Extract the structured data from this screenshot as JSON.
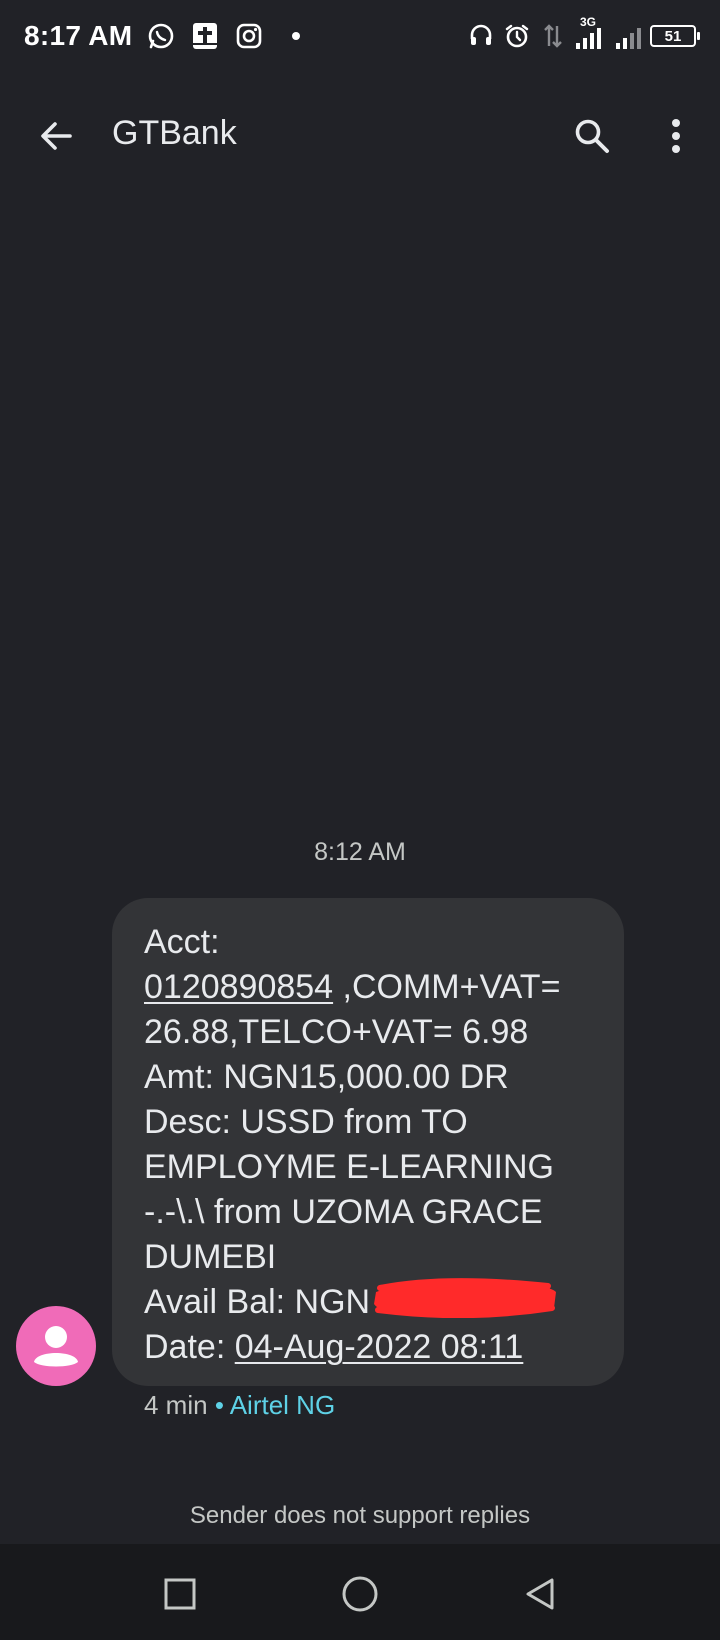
{
  "status_bar": {
    "time": "8:17 AM",
    "network_label": "3G",
    "battery": "51",
    "icons_left": [
      "whatsapp-icon",
      "bible-app-icon",
      "instagram-icon",
      "notification-dot"
    ],
    "icons_right": [
      "headset-icon",
      "alarm-icon",
      "data-arrows-icon",
      "signal-icon",
      "signal-icon-2",
      "battery-icon"
    ]
  },
  "app_bar": {
    "title": "GTBank",
    "icons": [
      "back-arrow-icon",
      "search-icon",
      "more-vert-icon"
    ]
  },
  "conversation": {
    "timestamp": "8:12 AM",
    "message": {
      "l1": "Acct:",
      "acct_number": "0120890854",
      "l2_rest": " ,COMM+VAT=",
      "l3": "26.88,TELCO+VAT= 6.98",
      "l4": "Amt: NGN15,000.00 DR",
      "l5": "Desc: USSD from TO",
      "l6": "EMPLOYME E-LEARNING",
      "l7": "-.-\\.\\ from UZOMA GRACE",
      "l8": "DUMEBI",
      "l9": "Avail Bal: NGN",
      "date_label": "Date: ",
      "date_value": "04-Aug-2022 08:11"
    },
    "meta_time": "4 min",
    "meta_separator": "•",
    "meta_carrier": "Airtel NG",
    "footer": "Sender does not support replies"
  },
  "colors": {
    "background": "#212227",
    "bubble": "#333437",
    "avatar": "#f06bb8",
    "carrier": "#5ed1e6",
    "redaction": "#ff2a2a"
  },
  "nav_bar": {
    "icons": [
      "recents-square-icon",
      "home-circle-icon",
      "back-triangle-icon"
    ]
  }
}
